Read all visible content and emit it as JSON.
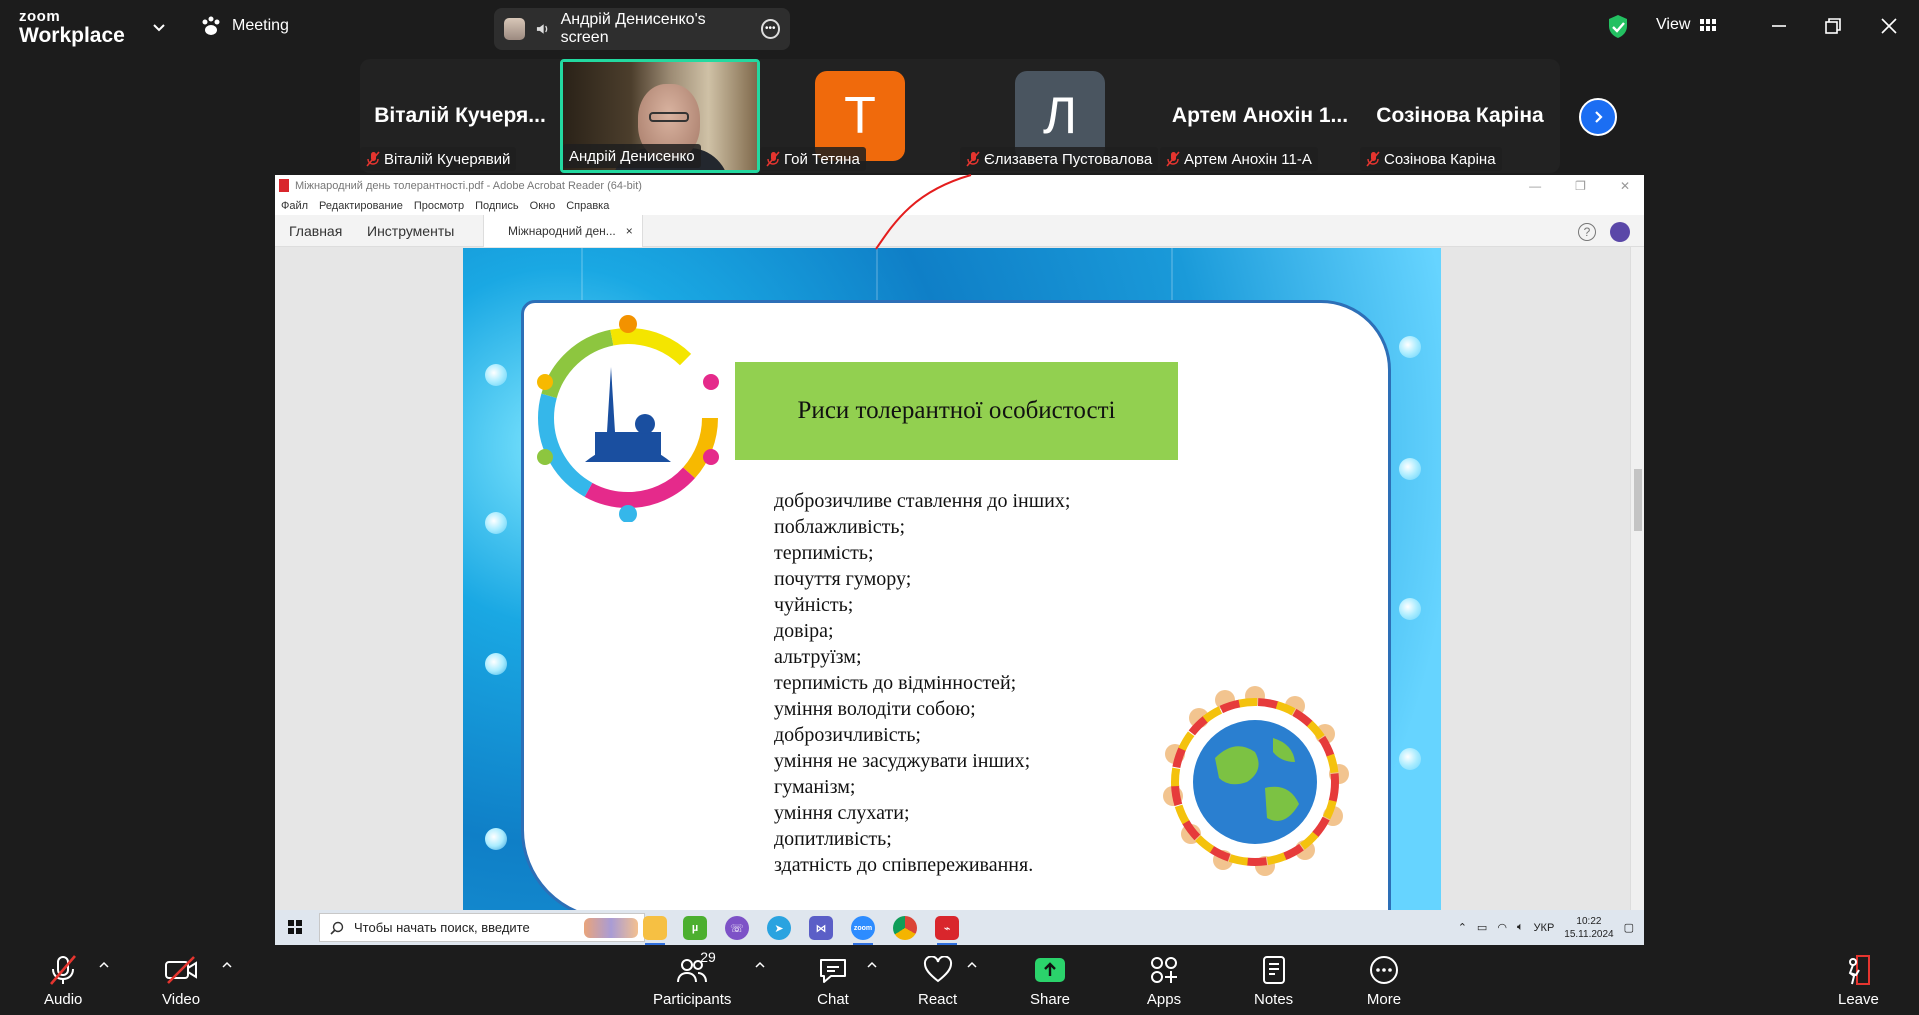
{
  "app": {
    "logo_line1": "zoom",
    "logo_line2": "Workplace",
    "meeting_label": "Meeting",
    "screen_share_label": "Андрій Денисенко's screen",
    "view_label": "View"
  },
  "participants": [
    {
      "big_name": "Віталій  Кучеря...",
      "label": "Віталій Кучерявий",
      "muted": true
    },
    {
      "big_name": "",
      "label": "Андрій Денисенко",
      "muted": false,
      "active": true
    },
    {
      "avatar_letter": "Т",
      "avatar_color": "#f06a0c",
      "label": "Гой Тетяна",
      "muted": true
    },
    {
      "avatar_letter": "Л",
      "avatar_color": "#4a5560",
      "label": "Єлизавета Пустовалова",
      "muted": true
    },
    {
      "big_name": "Артем  Анохін  1...",
      "label": "Артем Анохін 11-А",
      "muted": true
    },
    {
      "big_name": "Созінова Каріна",
      "label": "Созінова Каріна",
      "muted": true
    }
  ],
  "acrobat": {
    "window_title": "Міжнародний день толерантності.pdf - Adobe Acrobat Reader (64-bit)",
    "menu": [
      "Файл",
      "Редактирование",
      "Просмотр",
      "Подпись",
      "Окно",
      "Справка"
    ],
    "tab_home": "Главная",
    "tab_tools": "Инструменты",
    "doc_tab": "Міжнародний ден...",
    "doc_tab_close": "×",
    "help": "?"
  },
  "slide": {
    "heading": "Риси толерантної особистості",
    "marker": "",
    "items": [
      "доброзичливе ставлення до інших;",
      "поблажливість;",
      "терпимість;",
      "почуття гумору;",
      "чуйність;",
      "довіра;",
      "альтруїзм;",
      "терпимість до відмінностей;",
      "уміння володіти собою;",
      "доброзичливість;",
      "уміння не засуджувати інших;",
      "гуманізм;",
      "уміння слухати;",
      "допитливість;",
      "здатність до співпереживання."
    ]
  },
  "taskbar": {
    "search_placeholder": "Чтобы начать поиск, введите",
    "lang": "УКР",
    "time": "10:22",
    "date": "15.11.2024",
    "zoom_icon_text": "zoom"
  },
  "toolbar": {
    "audio": "Audio",
    "video": "Video",
    "participants": "Participants",
    "participants_count": "29",
    "chat": "Chat",
    "react": "React",
    "share": "Share",
    "apps": "Apps",
    "notes": "Notes",
    "more": "More",
    "leave": "Leave"
  },
  "colors": {
    "accent_active": "#23d9a0",
    "share_green": "#2bd36b",
    "mute_red": "#e5352f",
    "heading_green": "#92d050",
    "zoom_blue": "#1b6ef3"
  }
}
